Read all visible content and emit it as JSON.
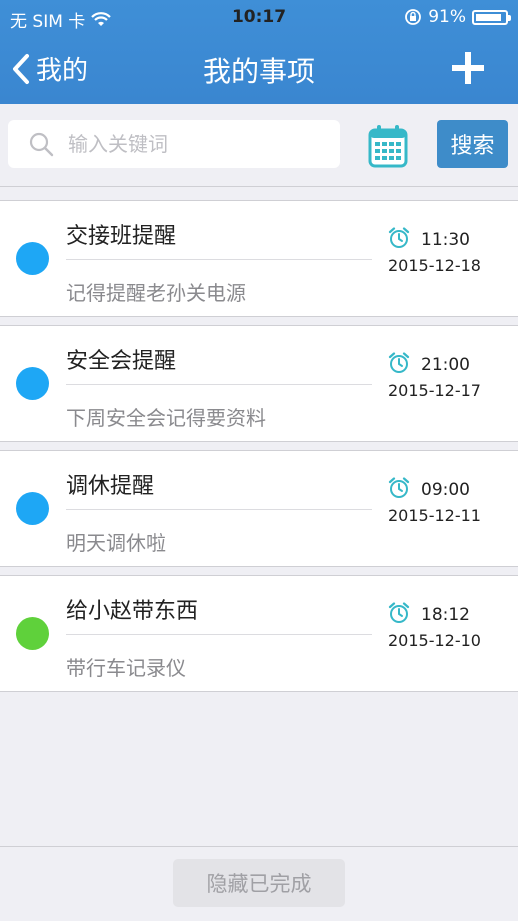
{
  "status_bar": {
    "carrier": "无 SIM 卡",
    "time": "10:17",
    "battery_percent_text": "91%",
    "battery_level": 0.91
  },
  "nav": {
    "back_label": "我的",
    "title": "我的事项"
  },
  "search": {
    "placeholder": "输入关键词",
    "button_label": "搜索"
  },
  "items": [
    {
      "title": "交接班提醒",
      "note": "记得提醒老孙关电源",
      "time": "11:30",
      "date": "2015-12-18",
      "dot_color": "#1ea7f5"
    },
    {
      "title": "安全会提醒",
      "note": "下周安全会记得要资料",
      "time": "21:00",
      "date": "2015-12-17",
      "dot_color": "#1ea7f5"
    },
    {
      "title": "调休提醒",
      "note": "明天调休啦",
      "time": "09:00",
      "date": "2015-12-11",
      "dot_color": "#1ea7f5"
    },
    {
      "title": "给小赵带东西",
      "note": "带行车记录仪",
      "time": "18:12",
      "date": "2015-12-10",
      "dot_color": "#5fd13b"
    }
  ],
  "footer": {
    "hide_completed_label": "隐藏已完成"
  },
  "colors": {
    "header": "#3a86d0",
    "accent": "#3e8cc9",
    "alarm_icon": "#36b8c8"
  }
}
